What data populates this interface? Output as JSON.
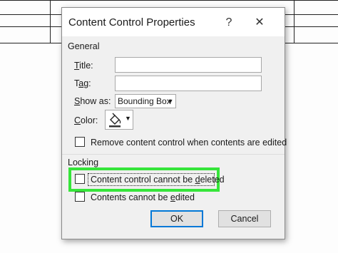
{
  "dialog": {
    "title": "Content Control Properties",
    "help_icon": "question-icon",
    "close_icon": "close-icon",
    "help_glyph": "?",
    "close_glyph": "✕"
  },
  "general": {
    "section_label": "General",
    "title_label_hotkey": "T",
    "title_label_rest": "itle:",
    "title_value": "",
    "tag_label_pre": "T",
    "tag_label_hotkey": "a",
    "tag_label_rest": "g:",
    "tag_value": "",
    "show_as_label_pre": "",
    "show_as_label_hotkey": "S",
    "show_as_label_rest": "how as:",
    "show_as_value": "Bounding Box",
    "color_label_pre": "",
    "color_label_hotkey": "C",
    "color_label_rest": "olor:",
    "color_icon": "paint-bucket-icon",
    "remove_label": "Remove content control when contents are edited",
    "remove_checked": false
  },
  "locking": {
    "section_label": "Locking",
    "cannot_delete_pre": "Content control cannot be ",
    "cannot_delete_hotkey": "d",
    "cannot_delete_rest": "eleted",
    "cannot_delete_checked": false,
    "cannot_edit_pre": "Contents cannot be ",
    "cannot_edit_hotkey": "e",
    "cannot_edit_rest": "dited",
    "cannot_edit_checked": false
  },
  "buttons": {
    "ok_label": "OK",
    "cancel_label": "Cancel"
  },
  "colors": {
    "highlight": "#36e53a",
    "dialog_bg": "#f0f0f0",
    "default_button_border": "#0078d7"
  }
}
